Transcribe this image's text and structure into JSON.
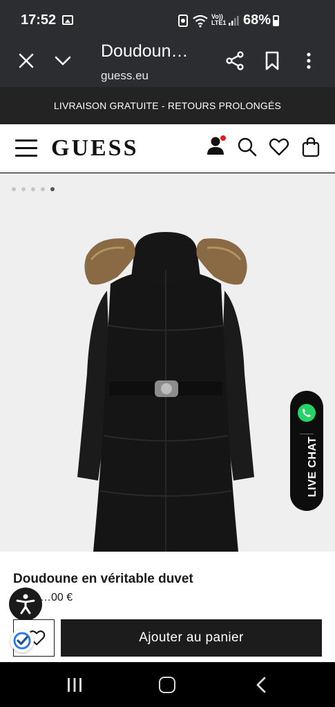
{
  "status_bar": {
    "time": "17:52",
    "battery": "68%",
    "network_label": "Vo)) LTE1",
    "icons": [
      "gallery-icon",
      "sync-icon",
      "wifi-icon",
      "signal-icon",
      "battery-icon"
    ]
  },
  "browser": {
    "title": "Doudoun…",
    "domain": "guess.eu",
    "icons": [
      "close-icon",
      "chevron-down-icon",
      "share-icon",
      "bookmark-icon",
      "more-vert-icon"
    ]
  },
  "promo": {
    "text": "LIVRAISON GRATUITE - RETOURS PROLONGÉS"
  },
  "header": {
    "logo": "GUESS",
    "icons": [
      "menu-icon",
      "user-icon",
      "search-icon",
      "heart-icon",
      "bag-icon"
    ],
    "notification_color": "#e02020"
  },
  "gallery": {
    "image_count": 5,
    "active_index": 4,
    "image": "black-down-coat-with-fur-hood"
  },
  "live_chat": {
    "label": "LIVE CHAT",
    "icon": "whatsapp-icon",
    "icon_color": "#25d366"
  },
  "product": {
    "name": "Doudoune en véritable duvet",
    "price": "…00 €",
    "add_to_cart_label": "Ajouter au panier"
  },
  "system_nav": {
    "icons": [
      "recent-apps-icon",
      "home-icon",
      "back-icon"
    ]
  }
}
